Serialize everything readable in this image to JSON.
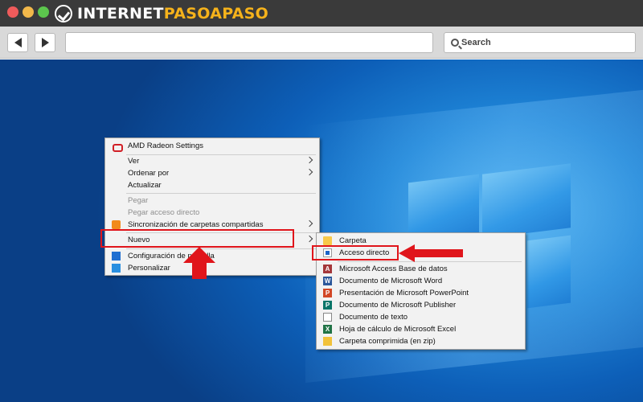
{
  "browser": {
    "logo": {
      "part1": "INTERNET",
      "part2": "PASOAPASO",
      "accent_color": "#f5b21b"
    },
    "search": {
      "placeholder": "Search"
    },
    "icons": [
      "back-arrow-icon",
      "forward-arrow-icon",
      "search-icon"
    ]
  },
  "context_menu": {
    "items": [
      {
        "label": "AMD Radeon Settings",
        "icon": "amd-radeon-icon"
      },
      {
        "label": "Ver",
        "has_submenu": true
      },
      {
        "label": "Ordenar por",
        "has_submenu": true
      },
      {
        "label": "Actualizar"
      },
      {
        "label": "Pegar",
        "disabled": true
      },
      {
        "label": "Pegar acceso directo",
        "disabled": true
      },
      {
        "label": "Sincronización de carpetas compartidas",
        "icon": "sync-icon",
        "has_submenu": true
      },
      {
        "label": "Nuevo",
        "has_submenu": true,
        "highlighted": true
      },
      {
        "label": "Configuración de pantalla",
        "icon": "display-settings-icon"
      },
      {
        "label": "Personalizar",
        "icon": "personalize-icon"
      }
    ]
  },
  "submenu_nuevo": {
    "items": [
      {
        "label": "Carpeta",
        "icon": "folder-icon"
      },
      {
        "label": "Acceso directo",
        "icon": "shortcut-icon",
        "highlighted": true
      },
      {
        "label": "Microsoft Access Base de datos",
        "icon": "access-icon"
      },
      {
        "label": "Documento de Microsoft Word",
        "icon": "word-icon"
      },
      {
        "label": "Presentación de Microsoft PowerPoint",
        "icon": "powerpoint-icon"
      },
      {
        "label": "Documento de Microsoft Publisher",
        "icon": "publisher-icon"
      },
      {
        "label": "Documento de texto",
        "icon": "text-document-icon"
      },
      {
        "label": "Hoja de cálculo de Microsoft Excel",
        "icon": "excel-icon"
      },
      {
        "label": "Carpeta comprimida (en zip)",
        "icon": "zip-folder-icon"
      }
    ]
  },
  "annotation_color": "#e0151b"
}
